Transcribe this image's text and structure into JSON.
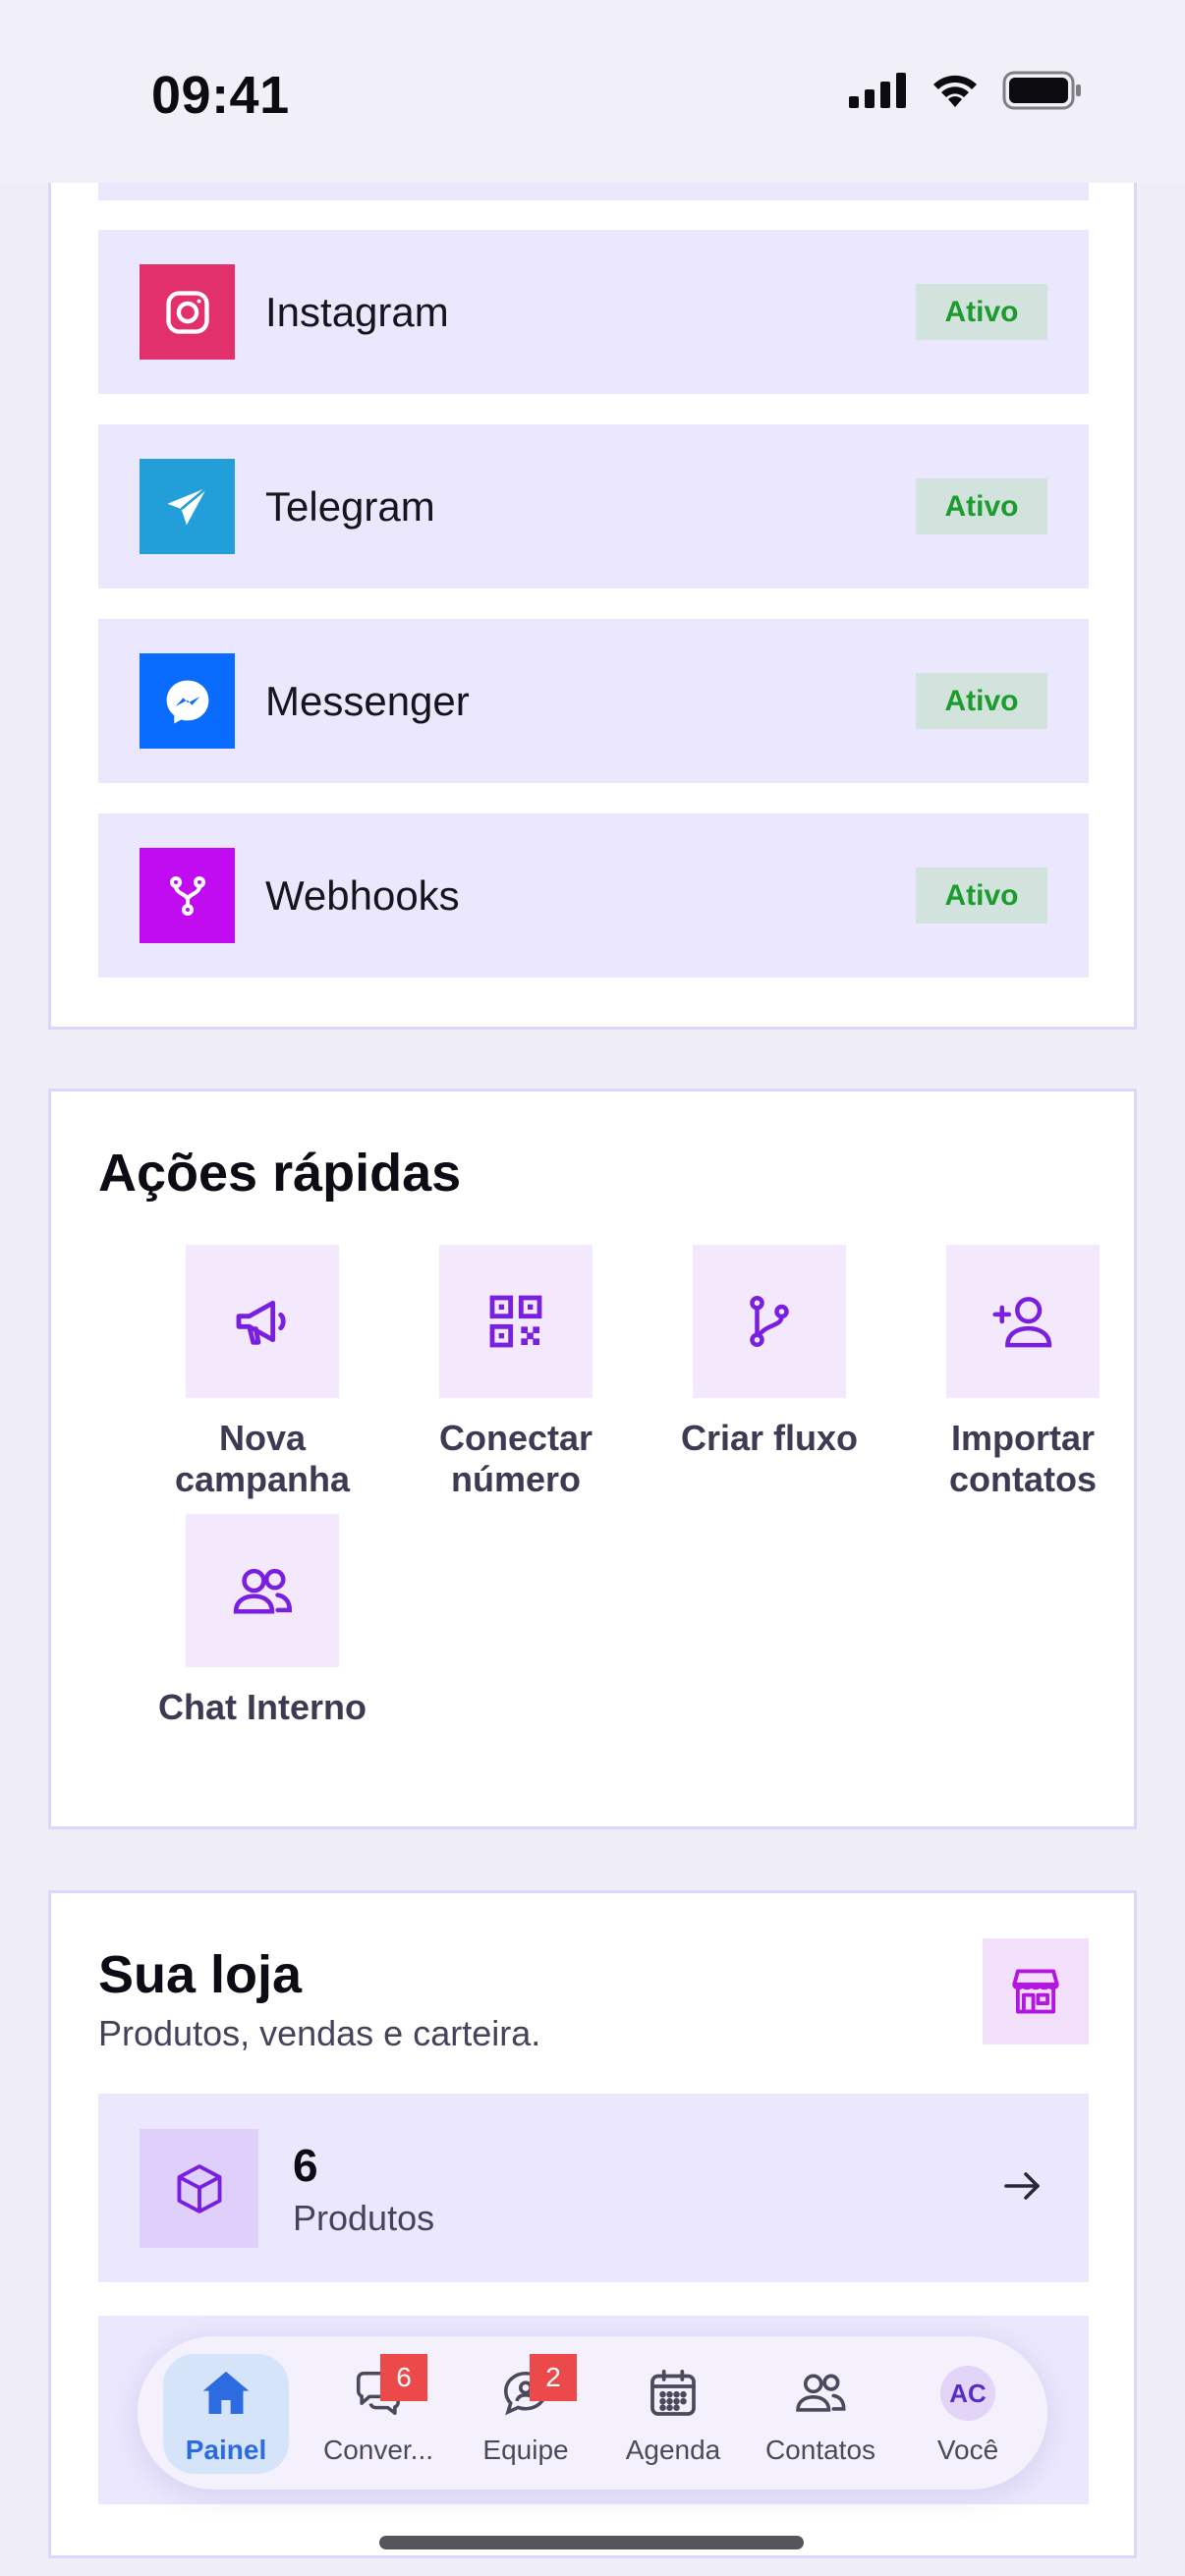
{
  "status_bar": {
    "time": "09:41"
  },
  "channels": [
    {
      "name": "Instagram",
      "status": "Ativo",
      "icon": "instagram-icon",
      "color": "#e1306c"
    },
    {
      "name": "Telegram",
      "status": "Ativo",
      "icon": "telegram-icon",
      "color": "#229ed9"
    },
    {
      "name": "Messenger",
      "status": "Ativo",
      "icon": "messenger-icon",
      "color": "#0a6cff"
    },
    {
      "name": "Webhooks",
      "status": "Ativo",
      "icon": "webhook-icon",
      "color": "#c10bf0"
    }
  ],
  "quick_actions": {
    "title": "Ações rápidas",
    "items": [
      {
        "label": "Nova campanha",
        "icon": "megaphone-icon"
      },
      {
        "label": "Conectar número",
        "icon": "qr-code-icon"
      },
      {
        "label": "Criar fluxo",
        "icon": "git-branch-icon"
      },
      {
        "label": "Importar contatos",
        "icon": "user-plus-icon"
      },
      {
        "label": "Chat Interno",
        "icon": "users-icon"
      }
    ]
  },
  "store": {
    "title": "Sua loja",
    "subtitle": "Produtos, vendas e carteira.",
    "icon": "storefront-icon",
    "products": {
      "count": "6",
      "label": "Produtos",
      "icon": "package-icon"
    }
  },
  "bottom_nav": [
    {
      "label": "Painel",
      "icon": "home-icon",
      "active": true
    },
    {
      "label": "Conver...",
      "icon": "chat-bubbles-icon",
      "badge": "6"
    },
    {
      "label": "Equipe",
      "icon": "team-chat-icon",
      "badge": "2"
    },
    {
      "label": "Agenda",
      "icon": "calendar-icon"
    },
    {
      "label": "Contatos",
      "icon": "contacts-icon"
    },
    {
      "label": "Você",
      "icon": "avatar",
      "initials": "AC"
    }
  ],
  "colors": {
    "accent": "#7a1fe0",
    "active_badge_bg": "#d2e3dd",
    "active_badge_text": "#1d9b2f",
    "nav_active": "#2d6ce0",
    "notification_badge": "#ec4a4a"
  }
}
